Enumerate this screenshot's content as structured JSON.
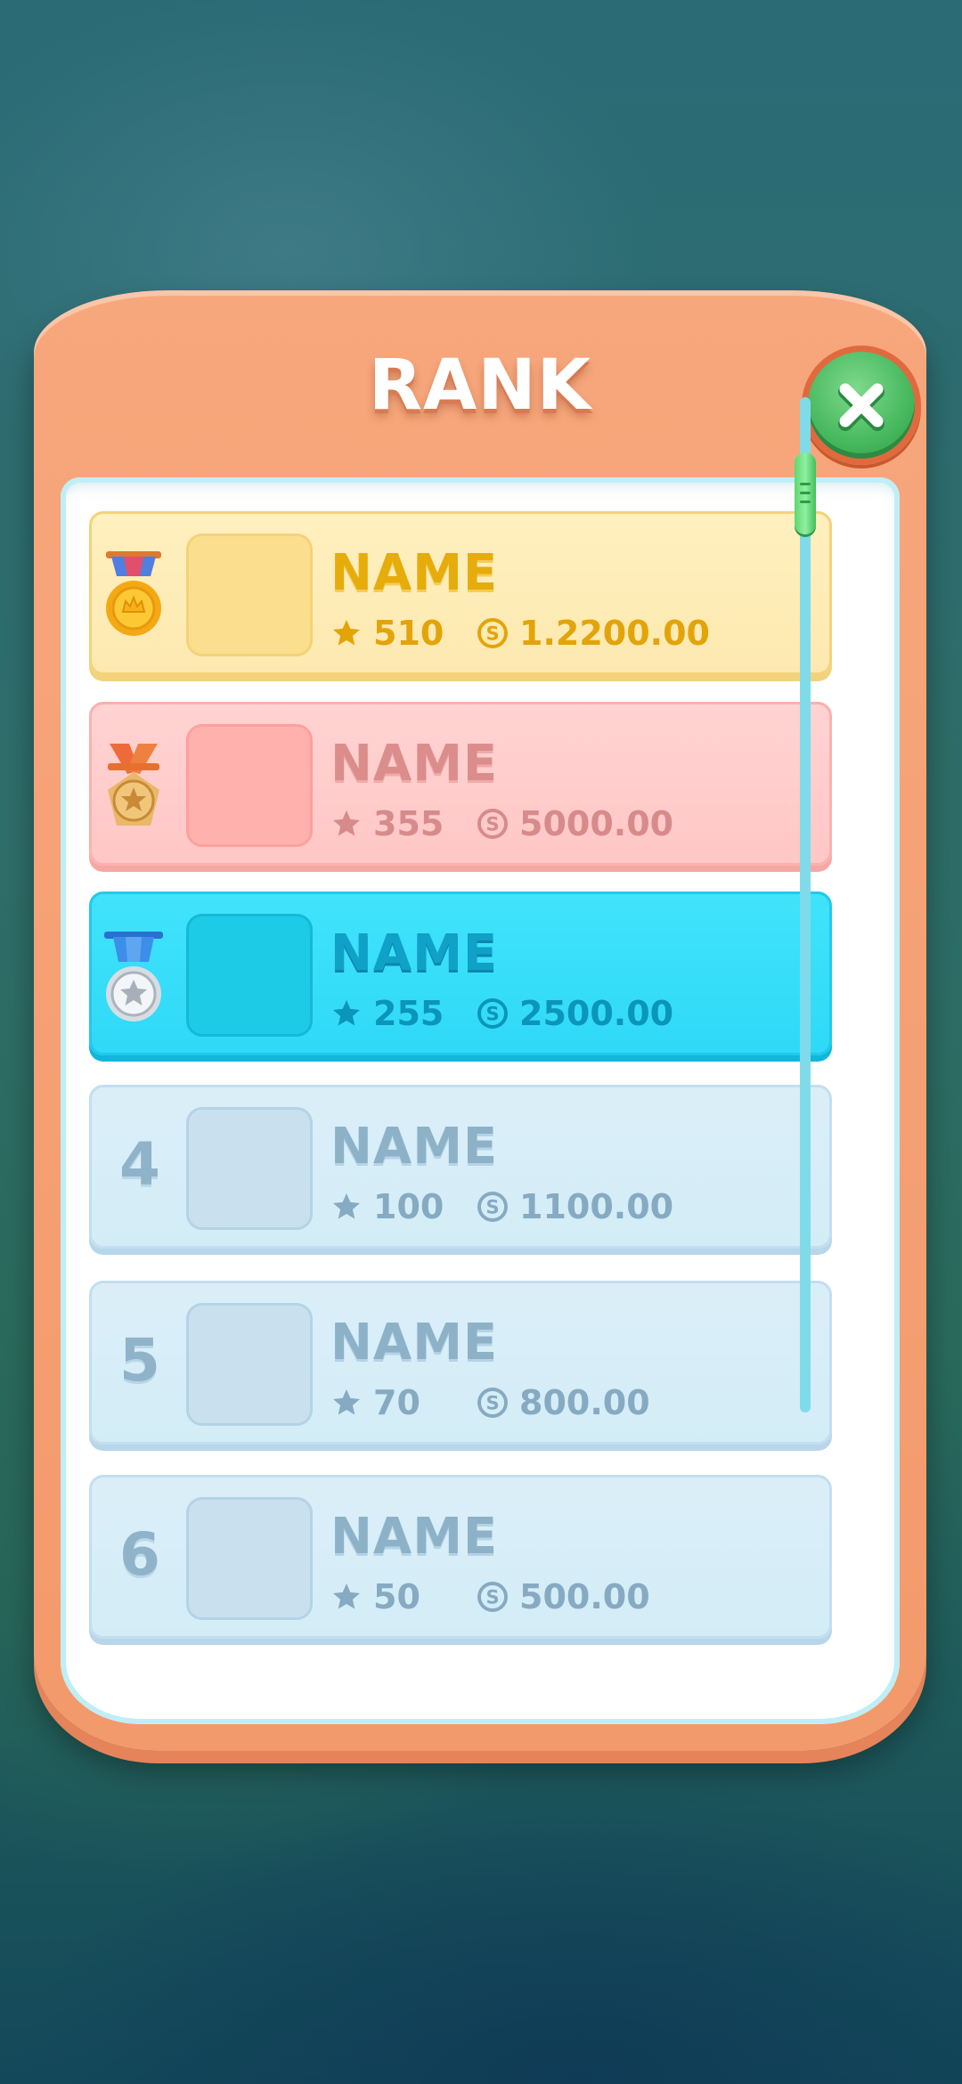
{
  "title": "RANK",
  "close_icon": "close-x-icon",
  "scroll": {
    "position_fraction": 0.1
  },
  "entries": [
    {
      "rank": "1",
      "badge": "gold-medal-icon",
      "name": "NAME",
      "stars": "510",
      "coins": "1.2200.00"
    },
    {
      "rank": "2",
      "badge": "silver-medal-icon",
      "name": "NAME",
      "stars": "355",
      "coins": "5000.00"
    },
    {
      "rank": "3",
      "badge": "bronze-medal-icon",
      "name": "NAME",
      "stars": "255",
      "coins": "2500.00"
    },
    {
      "rank": "4",
      "name": "NAME",
      "stars": "100",
      "coins": "1100.00"
    },
    {
      "rank": "5",
      "name": "NAME",
      "stars": "70",
      "coins": "800.00"
    },
    {
      "rank": "6",
      "name": "NAME",
      "stars": "50",
      "coins": "500.00"
    }
  ],
  "colors": {
    "panel": "#f39a6c",
    "gold_row": "#fde9b0",
    "second_row": "#ffc7c6",
    "third_row": "#2fd9f7",
    "plain_row": "#d3edf7",
    "close_button": "#46b85d"
  }
}
